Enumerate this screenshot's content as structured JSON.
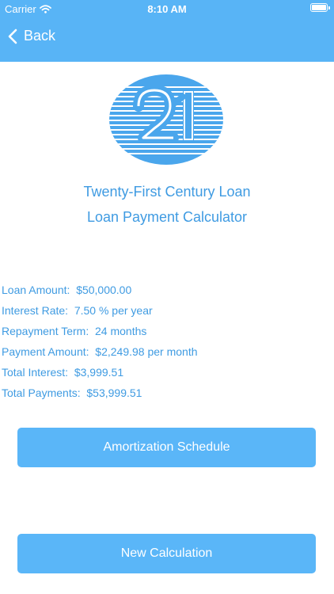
{
  "status_bar": {
    "carrier": "Carrier",
    "time": "8:10 AM"
  },
  "nav": {
    "back_label": "Back"
  },
  "header": {
    "title_line1": "Twenty-First Century Loan",
    "title_line2": "Loan Payment Calculator"
  },
  "results": [
    {
      "label": "Loan Amount:",
      "value": "$50,000.00"
    },
    {
      "label": "Interest Rate:",
      "value": "7.50 % per year"
    },
    {
      "label": "Repayment Term:",
      "value": "24 months"
    },
    {
      "label": "Payment Amount:",
      "value": "$2,249.98 per month"
    },
    {
      "label": "Total Interest:",
      "value": "$3,999.51"
    },
    {
      "label": "Total Payments:",
      "value": "$53,999.51"
    }
  ],
  "buttons": {
    "amortization": "Amortization Schedule",
    "new_calculation": "New Calculation"
  },
  "colors": {
    "header_bar": "#58b4f6",
    "text": "#3f9be2",
    "button": "#5ab6f8",
    "logo": "#4aa6ec"
  }
}
